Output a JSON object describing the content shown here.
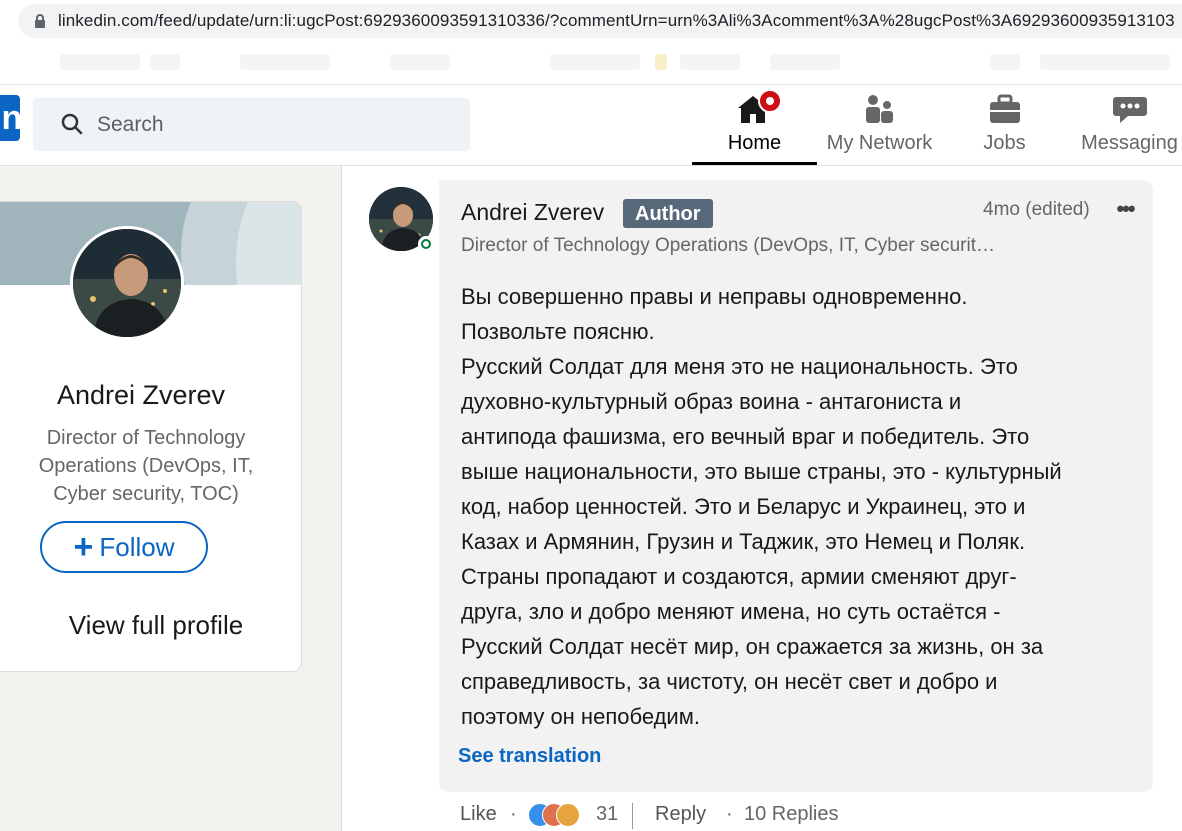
{
  "browser": {
    "url": "linkedin.com/feed/update/urn:li:ugcPost:6929360093591310336/?commentUrn=urn%3Ali%3Acomment%3A%28ugcPost%3A69293600935913103"
  },
  "header": {
    "search_placeholder": "Search",
    "nav": [
      {
        "label": "Home",
        "icon": "home-icon",
        "active": true
      },
      {
        "label": "My Network",
        "icon": "network-icon"
      },
      {
        "label": "Jobs",
        "icon": "briefcase-icon"
      },
      {
        "label": "Messaging",
        "icon": "messaging-icon"
      }
    ]
  },
  "profile_card": {
    "name": "Andrei Zverev",
    "headline": "Director of Technology Operations (DevOps, IT, Cyber security, TOC)",
    "follow_label": "Follow",
    "view_profile_label": "View full profile"
  },
  "comment": {
    "author": "Andrei Zverev",
    "badge": "Author",
    "time": "4mo (edited)",
    "headline": "Director of Technology Operations (DevOps, IT, Cyber securit…",
    "body": "Вы совершенно правы и неправы одновременно.\nПозвольте поясню.\nРусский Солдат для меня это не национальность. Это\nдуховно-культурный образ воина - антагониста и\nантипода фашизма, его вечный враг и победитель. Это\nвыше национальности, это выше страны, это - культурный\nкод, набор ценностей. Это и Беларус и Украинец, это и\nКазах и Армянин, Грузин и Таджик, это Немец и Поляк.\nСтраны пропадают и создаются, армии сменяют друг-\nдруга, зло и добро меняют имена, но суть остаётся -\nРусский Солдат несёт мир, он сражается за жизнь, он за\nсправедливость, за чистоту, он несёт свет и добро и\nпоэтому он непобедим.",
    "see_translation": "See translation",
    "like_label": "Like",
    "reaction_count": "31",
    "reply_label": "Reply",
    "replies_label": "10 Replies"
  },
  "colors": {
    "linkedin_blue": "#0a66c2",
    "notification_red": "#cc1016",
    "online_green": "#057642"
  }
}
